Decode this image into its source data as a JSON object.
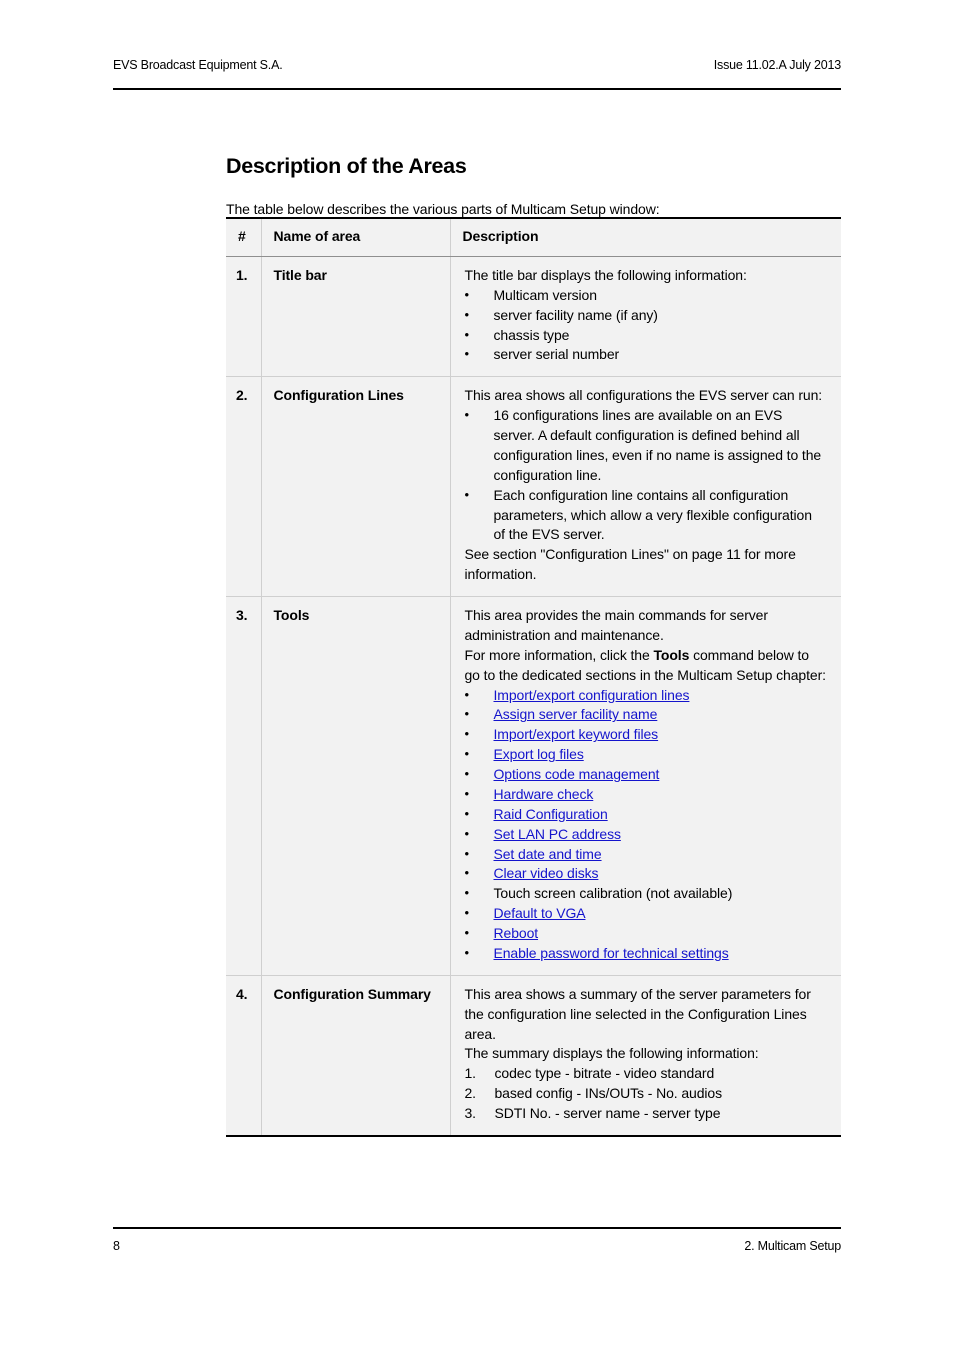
{
  "header": {
    "left": "EVS Broadcast Equipment S.A.",
    "right": "Issue 11.02.A  July 2013"
  },
  "section": {
    "title": "Description of the Areas",
    "intro": "The table below describes the various parts of Multicam Setup window:"
  },
  "table": {
    "columns": {
      "num": "#",
      "name": "Name of area",
      "description": "Description"
    },
    "rows": [
      {
        "num": "1.",
        "name": "Title bar",
        "lead": "The title bar displays the following information:",
        "bullets": [
          "Multicam version",
          "server facility name (if any)",
          "chassis type",
          "server serial number"
        ]
      },
      {
        "num": "2.",
        "name": "Configuration Lines",
        "lead": "This area shows all configurations the EVS server can run:",
        "bullets": [
          "16 configurations lines are available on an EVS server. A default configuration is defined behind all configuration lines, even if no name is assigned to the configuration line.",
          "Each configuration line contains all configuration parameters, which allow a very flexible configuration of the EVS server."
        ],
        "closing": "See section \"Configuration Lines\" on page 11 for more information."
      },
      {
        "num": "3.",
        "name": "Tools",
        "lead1": "This area provides the main commands for server administration and maintenance.",
        "lead2_before": "For more information, click the ",
        "lead2_bold": "Tools",
        "lead2_after": " command below to go to the dedicated sections in the Multicam Setup chapter:",
        "links": [
          {
            "label": "Import/export configuration lines",
            "is_link": true
          },
          {
            "label": "Assign server facility name",
            "is_link": true
          },
          {
            "label": "Import/export keyword files",
            "is_link": true
          },
          {
            "label": "Export log files",
            "is_link": true
          },
          {
            "label": "Options code management",
            "is_link": true
          },
          {
            "label": "Hardware check",
            "is_link": true
          },
          {
            "label": "Raid Configuration",
            "is_link": true
          },
          {
            "label": "Set LAN PC address",
            "is_link": true
          },
          {
            "label": "Set date and time",
            "is_link": true
          },
          {
            "label": "Clear video disks",
            "is_link": true
          },
          {
            "label": "Touch screen calibration (not available)",
            "is_link": false
          },
          {
            "label": "Default to VGA",
            "is_link": true
          },
          {
            "label": "Reboot",
            "is_link": true
          },
          {
            "label": "Enable password for technical settings",
            "is_link": true
          }
        ]
      },
      {
        "num": "4.",
        "name": "Configuration Summary",
        "lead1": "This area shows a summary of the server parameters for the configuration line selected in the Configuration Lines area.",
        "lead2": "The summary displays the following information:",
        "numbered": [
          {
            "marker": "1.",
            "label": "codec type - bitrate - video standard"
          },
          {
            "marker": "2.",
            "label": "based config - INs/OUTs - No. audios"
          },
          {
            "marker": "3.",
            "label": "SDTI No. - server name - server type"
          }
        ]
      }
    ]
  },
  "footer": {
    "page_number": "8",
    "chapter": "2. Multicam Setup"
  },
  "bullet_glyph": "•",
  "colors": {
    "link": "#1414cc",
    "table_background": "#f2f2f2",
    "rule": "#000000"
  }
}
